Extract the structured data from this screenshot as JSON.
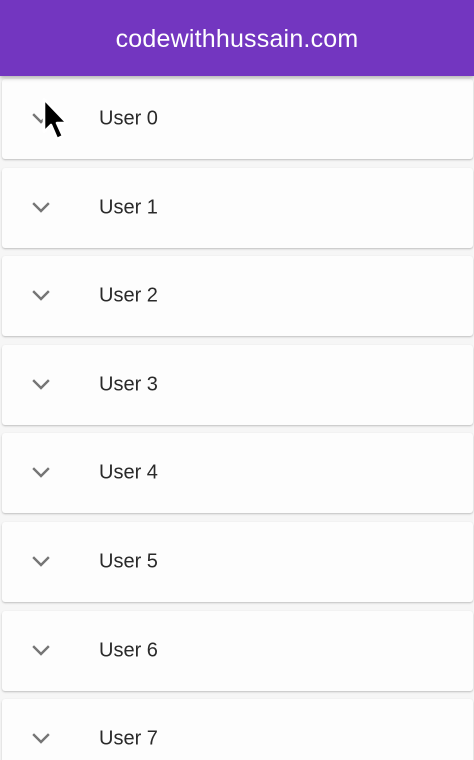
{
  "app_bar": {
    "title": "codewithhussain.com",
    "color": "#7336c0"
  },
  "list": {
    "items": [
      {
        "label": "User 0",
        "icon": "chevron-down-icon",
        "expanded": false
      },
      {
        "label": "User 1",
        "icon": "chevron-down-icon",
        "expanded": false
      },
      {
        "label": "User 2",
        "icon": "chevron-down-icon",
        "expanded": false
      },
      {
        "label": "User 3",
        "icon": "chevron-down-icon",
        "expanded": false
      },
      {
        "label": "User 4",
        "icon": "chevron-down-icon",
        "expanded": false
      },
      {
        "label": "User 5",
        "icon": "chevron-down-icon",
        "expanded": false
      },
      {
        "label": "User 6",
        "icon": "chevron-down-icon",
        "expanded": false
      },
      {
        "label": "User 7",
        "icon": "chevron-down-icon",
        "expanded": false
      }
    ]
  },
  "cursor": {
    "icon": "mouse-pointer-icon"
  }
}
